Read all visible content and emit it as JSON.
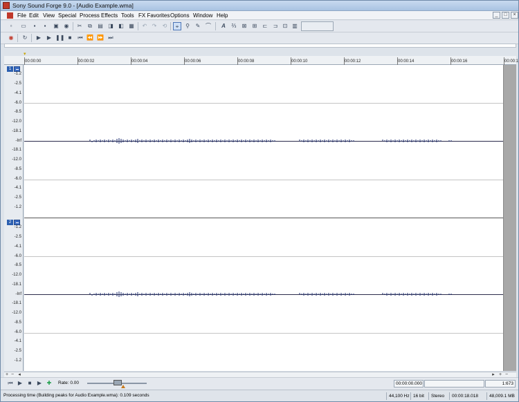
{
  "window": {
    "title": "Sony Sound Forge 9.0 - [Audio Example.wma]"
  },
  "menu": [
    "File",
    "Edit",
    "View",
    "Special",
    "Process",
    "Effects",
    "Tools",
    "FX Favorites",
    "Options",
    "Window",
    "Help"
  ],
  "mdi_controls": [
    "_",
    "□",
    "×"
  ],
  "toolbar1": [
    "new-icon",
    "open-icon",
    "save-icon",
    "save-as-icon",
    "render-icon",
    "properties-icon",
    "cut-icon",
    "copy-icon",
    "paste-icon",
    "mix-icon",
    "trim-icon",
    "undo-icon",
    "redo-icon",
    "repeat-icon",
    "edit-tool-icon",
    "magnify-tool-icon",
    "pencil-tool-icon",
    "envelope-tool-icon",
    "font-icon",
    "snap-icon",
    "marker-icon",
    "region-icon",
    "loop-icon",
    "crop-icon",
    "crossfade-icon",
    "meter-icon"
  ],
  "toolbar2": [
    "record-icon",
    "loop-icon",
    "play-all-icon",
    "play-icon",
    "pause-icon",
    "stop-icon",
    "go-start-icon",
    "rewind-icon",
    "forward-icon",
    "go-end-icon"
  ],
  "ruler": [
    "00:00:00",
    "00:00:02",
    "00:00:04",
    "00:00:06",
    "00:00:08",
    "00:00:10",
    "00:00:12",
    "00:00:14",
    "00:00:16",
    "00:00:1"
  ],
  "db_scale": [
    "-1.2",
    "-2.5",
    "-4.1",
    "-6.0",
    "-8.5",
    "-12.0",
    "-18.1",
    "-Inf",
    "-18.1",
    "-12.0",
    "-8.5",
    "-6.0",
    "-4.1",
    "-2.5",
    "-1.2"
  ],
  "channels": [
    {
      "number": "1"
    },
    {
      "number": "2"
    }
  ],
  "transport": {
    "rate_label": "Rate: 0.00",
    "position": "00:00:00.000",
    "zoom": "1:673"
  },
  "status": {
    "message": "Processing time (Building peaks for Audio Example.wma): 0.109 seconds",
    "sample_rate": "44,100 Hz",
    "bit_depth": "16 bit",
    "channels": "Stereo",
    "length": "00:00:18.018",
    "free_space": "48,009.1 MB"
  },
  "colors": {
    "waveform": "#1a2a6c",
    "channel_badge": "#2b5fb0"
  }
}
